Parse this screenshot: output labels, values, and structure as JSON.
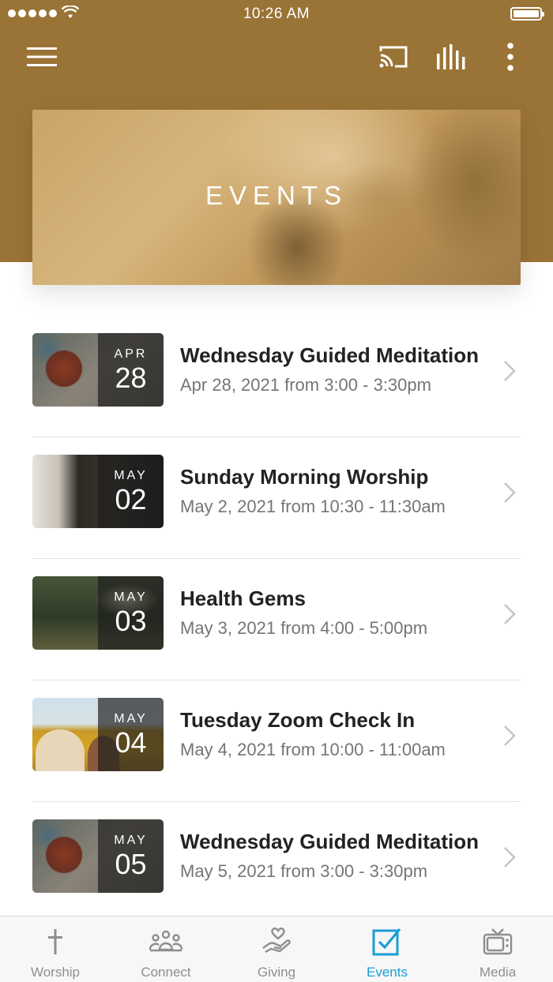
{
  "status_bar": {
    "time": "10:26 AM"
  },
  "header": {
    "menu_icon": "hamburger-menu-icon",
    "cast_icon": "cast-icon",
    "audio_icon": "audio-bars-icon",
    "more_icon": "vertical-ellipsis-icon",
    "background_color": "#9a7336"
  },
  "hero": {
    "title": "EVENTS"
  },
  "events": [
    {
      "month": "APR",
      "day": "28",
      "title": "Wednesday Guided Meditation",
      "time": "Apr 28, 2021 from 3:00 - 3:30pm"
    },
    {
      "month": "MAY",
      "day": "02",
      "title": "Sunday Morning Worship",
      "time": "May 2, 2021 from 10:30 - 11:30am"
    },
    {
      "month": "MAY",
      "day": "03",
      "title": "Health Gems",
      "time": "May 3, 2021 from 4:00 - 5:00pm"
    },
    {
      "month": "MAY",
      "day": "04",
      "title": "Tuesday Zoom Check In",
      "time": "May 4, 2021 from 10:00 - 11:00am"
    },
    {
      "month": "MAY",
      "day": "05",
      "title": "Wednesday Guided Meditation",
      "time": "May 5, 2021 from 3:00 - 3:30pm"
    }
  ],
  "tabs": [
    {
      "label": "Worship",
      "icon": "cross-icon",
      "active": false
    },
    {
      "label": "Connect",
      "icon": "people-icon",
      "active": false
    },
    {
      "label": "Giving",
      "icon": "heart-hand-icon",
      "active": false
    },
    {
      "label": "Events",
      "icon": "checkbox-icon",
      "active": true
    },
    {
      "label": "Media",
      "icon": "tv-icon",
      "active": false
    }
  ],
  "colors": {
    "accent": "#1a9fd6",
    "inactive_tab": "#8e8e8e",
    "header": "#9a7336"
  }
}
